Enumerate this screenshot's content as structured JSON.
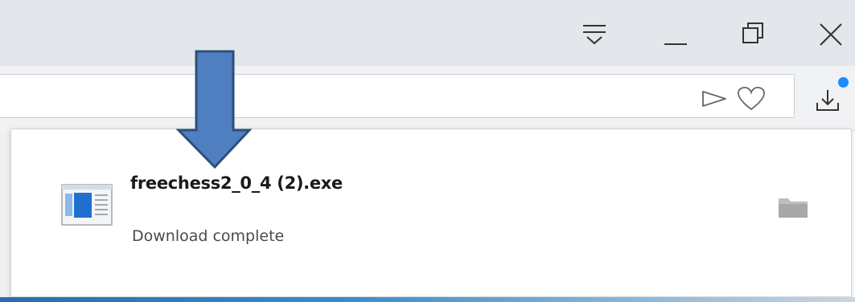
{
  "download": {
    "file_name": "freechess2_0_4 (2).exe",
    "status": "Download complete"
  },
  "icons": {
    "minimize_all": "easy-files-icon",
    "minimize": "minimize-icon",
    "restore": "restore-icon",
    "close": "close-icon",
    "send": "send-icon",
    "heart": "heart-icon",
    "download": "download-icon",
    "file": "exe-file-icon",
    "folder": "folder-icon",
    "arrow": "down-arrow-annotation"
  },
  "colors": {
    "arrow_fill": "#4f7fc1",
    "arrow_stroke": "#2e4f7c",
    "badge": "#1a8cff",
    "titlebar": "#e3e6eb"
  }
}
